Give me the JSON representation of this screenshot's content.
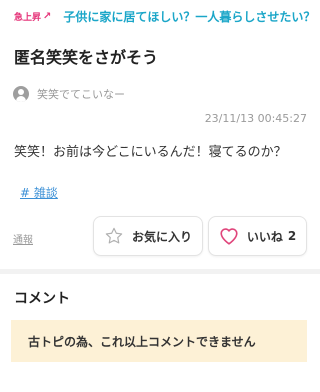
{
  "trending": {
    "badge": "急上昇",
    "headline": "子供に家に居てほしい？一人暮らしさせたい？"
  },
  "post": {
    "title": "匿名笑笑をさがそう",
    "author": "笑笑でてこいなー",
    "timestamp": "23/11/13 00:45:27",
    "body": "笑笑！お前は今どこにいるんだ！寝てるのか？",
    "tag": "# 雑談"
  },
  "actions": {
    "report_label": "通報",
    "favorite_label": "お気に入り",
    "like_label": "いいね",
    "like_count": "2"
  },
  "comments": {
    "heading": "コメント",
    "closed_notice": "古トピの為、これ以上コメントできません"
  },
  "colors": {
    "trending_badge": "#e5357a",
    "trending_text": "#1ba6c8",
    "tag_link": "#3a8fd6",
    "like_heart": "#e0457b",
    "notice_bg": "#fdf1d6"
  }
}
